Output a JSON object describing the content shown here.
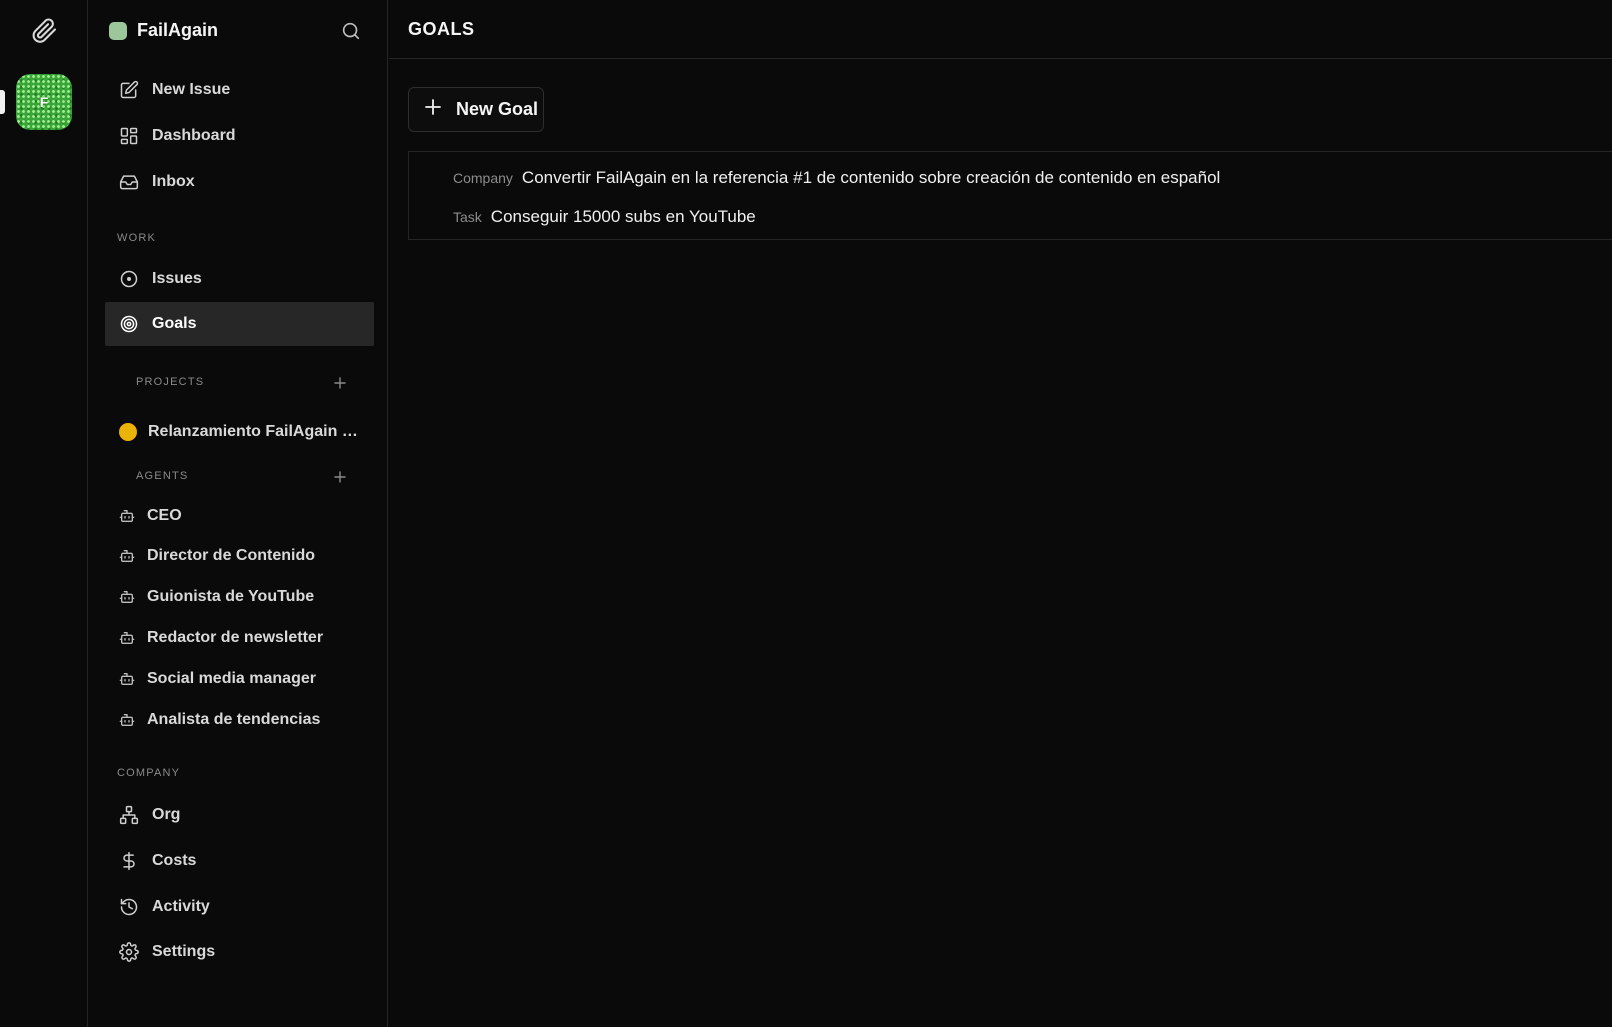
{
  "rail": {
    "avatar_letter": "F",
    "avatar_color": "#3aa53a"
  },
  "sidebar": {
    "company_name": "FailAgain",
    "company_color": "#9cc79a",
    "top_items": [
      {
        "label": "New Issue",
        "icon": "edit-icon"
      },
      {
        "label": "Dashboard",
        "icon": "dashboard-icon"
      },
      {
        "label": "Inbox",
        "icon": "inbox-icon"
      }
    ],
    "work_label": "WORK",
    "work_items": [
      {
        "label": "Issues",
        "icon": "circle-dot-icon"
      },
      {
        "label": "Goals",
        "icon": "target-icon",
        "active": true
      }
    ],
    "projects_label": "PROJECTS",
    "projects": [
      {
        "label": "Relanzamiento FailAgain 2...",
        "color": "#eab308"
      }
    ],
    "agents_label": "AGENTS",
    "agents": [
      {
        "label": "CEO"
      },
      {
        "label": "Director de Contenido"
      },
      {
        "label": "Guionista de YouTube"
      },
      {
        "label": "Redactor de newsletter"
      },
      {
        "label": "Social media manager"
      },
      {
        "label": "Analista de tendencias"
      }
    ],
    "company_label": "COMPANY",
    "company_items": [
      {
        "label": "Org",
        "icon": "org-chart-icon"
      },
      {
        "label": "Costs",
        "icon": "dollar-icon"
      },
      {
        "label": "Activity",
        "icon": "history-icon"
      },
      {
        "label": "Settings",
        "icon": "gear-icon"
      }
    ]
  },
  "main": {
    "title": "GOALS",
    "new_goal_label": "New Goal",
    "goals": [
      {
        "type": "Company",
        "title": "Convertir FailAgain en la referencia #1 de contenido sobre creación de contenido en español"
      },
      {
        "type": "Task",
        "title": "Conseguir 15000 subs en YouTube"
      }
    ]
  },
  "colors": {
    "background": "#0a0a0a",
    "active_item": "#272727",
    "border": "#262626",
    "project_dot": "#eab308"
  }
}
